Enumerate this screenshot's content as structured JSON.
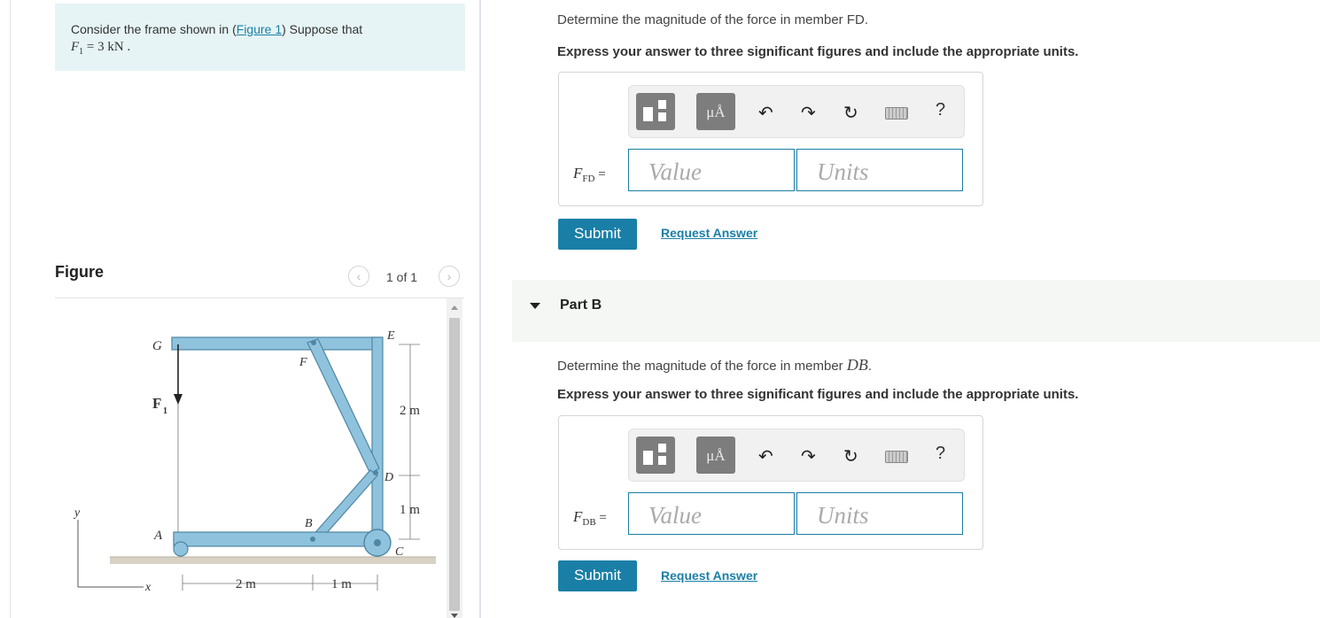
{
  "problem": {
    "text_before": "Consider the frame shown in (",
    "figure_link": "Figure 1",
    "text_after": ") Suppose that",
    "force_sym": "F",
    "force_sub": "1",
    "force_val": " = 3  kN ."
  },
  "figure": {
    "title": "Figure",
    "pager": "1 of 1",
    "labels": {
      "G": "G",
      "F_point": "F",
      "E": "E",
      "D": "D",
      "B": "B",
      "A": "A",
      "C": "C",
      "force_name": "F",
      "force_sub": "1",
      "dim_2m_vert": "2 m",
      "dim_1m_vert": "1 m",
      "dim_2m_horiz": "2 m",
      "dim_1m_horiz": "1 m",
      "axis_y": "y",
      "axis_x": "x"
    }
  },
  "part_a": {
    "question_cut": "Determine the magnitude of the force in member FD.",
    "instruction": "Express your answer to three significant figures and include the appropriate units.",
    "var_sym": "F",
    "var_sub": "FD",
    "value_placeholder": "Value",
    "units_placeholder": "Units",
    "submit_label": "Submit",
    "request_label": "Request Answer"
  },
  "part_b": {
    "title": "Part B",
    "question_text": "Determine the magnitude of the force in member ",
    "question_member": "DB",
    "question_end": ".",
    "instruction": "Express your answer to three significant figures and include the appropriate units.",
    "var_sym": "F",
    "var_sub": "DB",
    "value_placeholder": "Value",
    "units_placeholder": "Units",
    "submit_label": "Submit",
    "request_label": "Request Answer"
  },
  "toolbar": {
    "units_button": "μÅ",
    "undo_icon": "undo-icon",
    "redo_icon": "redo-icon",
    "reset_icon": "reset-icon",
    "keyboard_icon": "keyboard-icon",
    "help": "?"
  },
  "colors": {
    "accent": "#1a7fa6",
    "problem_bg": "#e6f4f5",
    "frame": "#8fc3dd"
  }
}
